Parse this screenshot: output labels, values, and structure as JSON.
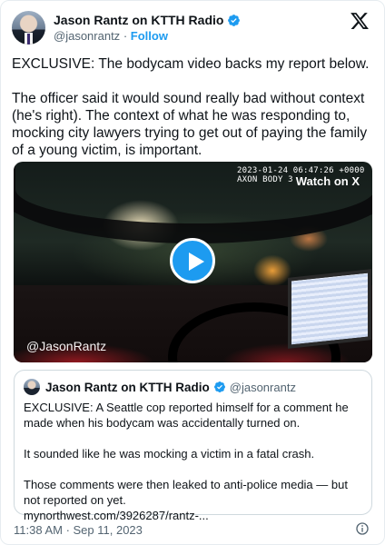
{
  "author": {
    "name": "Jason Rantz on KTTH Radio",
    "handle": "@jasonrantz",
    "separator": "·",
    "follow_label": "Follow"
  },
  "tweet": {
    "text": "EXCLUSIVE: The bodycam video backs my report below.\n\nThe officer said it would sound really bad without context (he's right). The context of what he was responding to, mocking city lawyers trying to get out of paying the family of a young victim, is important."
  },
  "video": {
    "overlay_timestamp": "2023-01-24 06:47:26 +0000\nAXON BODY 3",
    "watch_label": "Watch on X",
    "watermark": "@JasonRantz",
    "play_icon": "play-icon"
  },
  "quoted_tweet": {
    "name": "Jason Rantz on KTTH Radio",
    "handle": "@jasonrantz",
    "text": "EXCLUSIVE: A Seattle cop reported himself for a comment he made when his bodycam was accidentally turned on.\n\nIt sounded like he was mocking a victim in a fatal crash.\n\nThose comments were then leaked to anti-police media — but not reported on yet.\nmynorthwest.com/3926287/rantz-..."
  },
  "footer": {
    "timestamp": "11:38 AM · Sep 11, 2023"
  },
  "colors": {
    "accent": "#1d9bf0",
    "text": "#0f1419",
    "muted": "#536471"
  }
}
